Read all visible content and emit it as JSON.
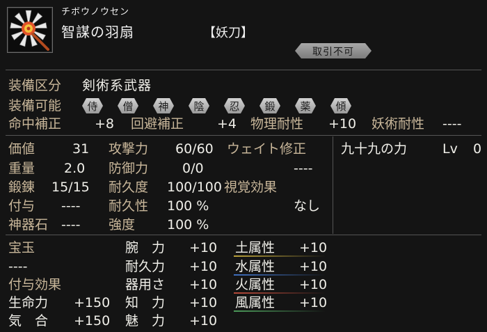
{
  "header": {
    "kana_name": "チボウノウセン",
    "item_name": "智謀の羽扇",
    "item_type": "【妖刀】",
    "trade_label": "取引不可"
  },
  "equip": {
    "category_label": "装備区分",
    "category_value": "剣術系武器",
    "usable_label": "装備可能",
    "classes": [
      "侍",
      "僧",
      "神",
      "陰",
      "忍",
      "鍛",
      "薬",
      "傾"
    ]
  },
  "bonuses": {
    "hit_label": "命中補正",
    "hit_value": "+8",
    "evade_label": "回避補正",
    "evade_value": "+4",
    "phys_label": "物理耐性",
    "phys_value": "+10",
    "magic_label": "妖術耐性",
    "magic_value": "----"
  },
  "stats": {
    "price_label": "価値",
    "price_value": "31",
    "weight_label": "重量",
    "weight_value": "2.0",
    "forge_label": "鍛錬",
    "forge_value": "15/15",
    "grant_label": "付与",
    "grant_value": "----",
    "stone_label": "神器石",
    "stone_value": "----",
    "attack_label": "攻撃力",
    "attack_value": "60/60",
    "defense_label": "防御力",
    "defense_value": "0/0",
    "durability_label": "耐久度",
    "durability_value": "100/100",
    "durable_label": "耐久性",
    "durable_value": "100 %",
    "strength_label": "強度",
    "strength_value": "100 %",
    "weight_fix_label": "ウェイト修正",
    "weight_fix_value": "----",
    "visual_label": "視覚効果",
    "visual_value": "なし"
  },
  "skill": {
    "name": "九十九の力",
    "level_label": "Lv",
    "level_value": "0"
  },
  "gems": {
    "gem_label": "宝玉",
    "gem_value": "----",
    "effect_label": "付与効果",
    "life_label": "生命力",
    "life_value": "+150",
    "ki_label": "気　合",
    "ki_value": "+150"
  },
  "attrs": [
    {
      "label": "腕　力",
      "value": "+10"
    },
    {
      "label": "耐久力",
      "value": "+10"
    },
    {
      "label": "器用さ",
      "value": "+10"
    },
    {
      "label": "知　力",
      "value": "+10"
    },
    {
      "label": "魅　力",
      "value": "+10"
    }
  ],
  "elements": [
    {
      "label": "土属性",
      "value": "+10",
      "color": "#b8a03a"
    },
    {
      "label": "水属性",
      "value": "+10",
      "color": "#3f6fbf"
    },
    {
      "label": "火属性",
      "value": "+10",
      "color": "#b84a3a"
    },
    {
      "label": "風属性",
      "value": "+10",
      "color": "#4c9a5a"
    }
  ]
}
